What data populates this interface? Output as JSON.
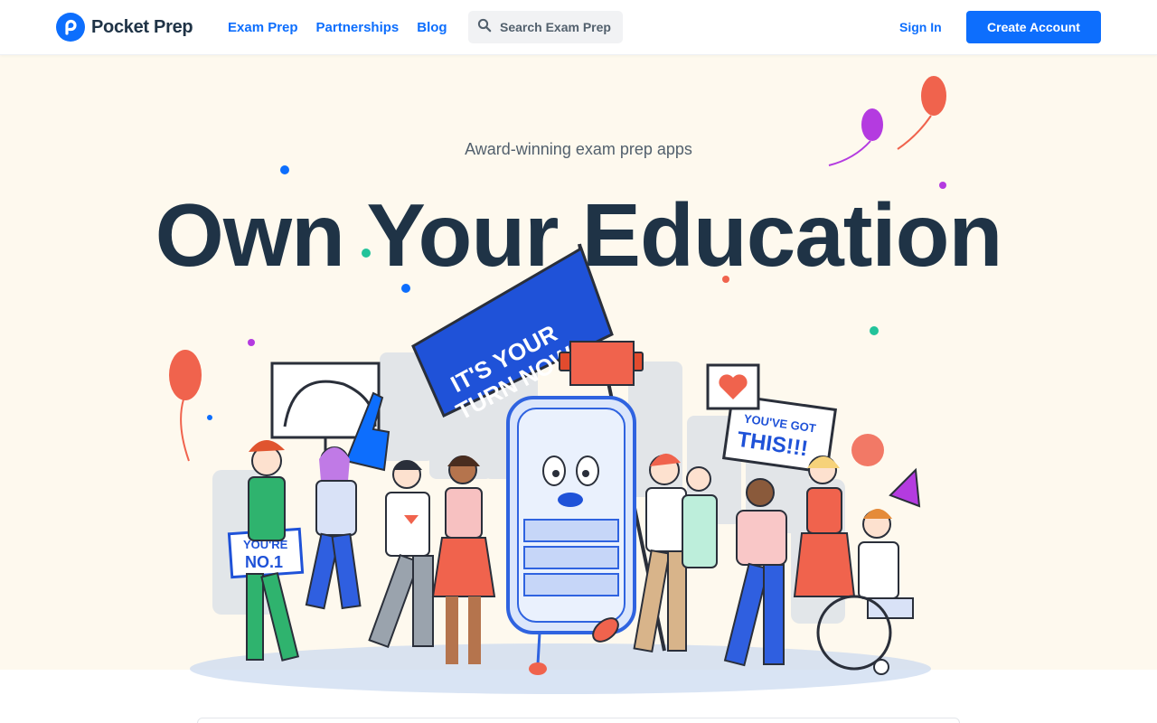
{
  "header": {
    "brand_name": "Pocket Prep",
    "logo_icon": "pocket-prep-logo-icon",
    "nav_items": [
      {
        "label": "Exam Prep"
      },
      {
        "label": "Partnerships"
      },
      {
        "label": "Blog"
      }
    ],
    "search": {
      "placeholder": "Search Exam Prep",
      "icon": "search-icon"
    },
    "sign_in_label": "Sign In",
    "create_account_label": "Create Account"
  },
  "hero": {
    "eyebrow": "Award-winning exam prep apps",
    "headline": "Own Your Education",
    "illustration": {
      "flag_text_line1": "IT'S YOUR",
      "flag_text_line2": "TURN NOW",
      "sign_left_line1": "YOU'RE",
      "sign_left_line2": "NO.1",
      "sign_right_line1": "YOU'VE GOT",
      "sign_right_line2": "THIS!!!"
    }
  },
  "colors": {
    "brand_blue": "#0d6efd",
    "heading_navy": "#1f3346",
    "hero_background": "#fef9ee",
    "muted_text": "#52606d"
  }
}
